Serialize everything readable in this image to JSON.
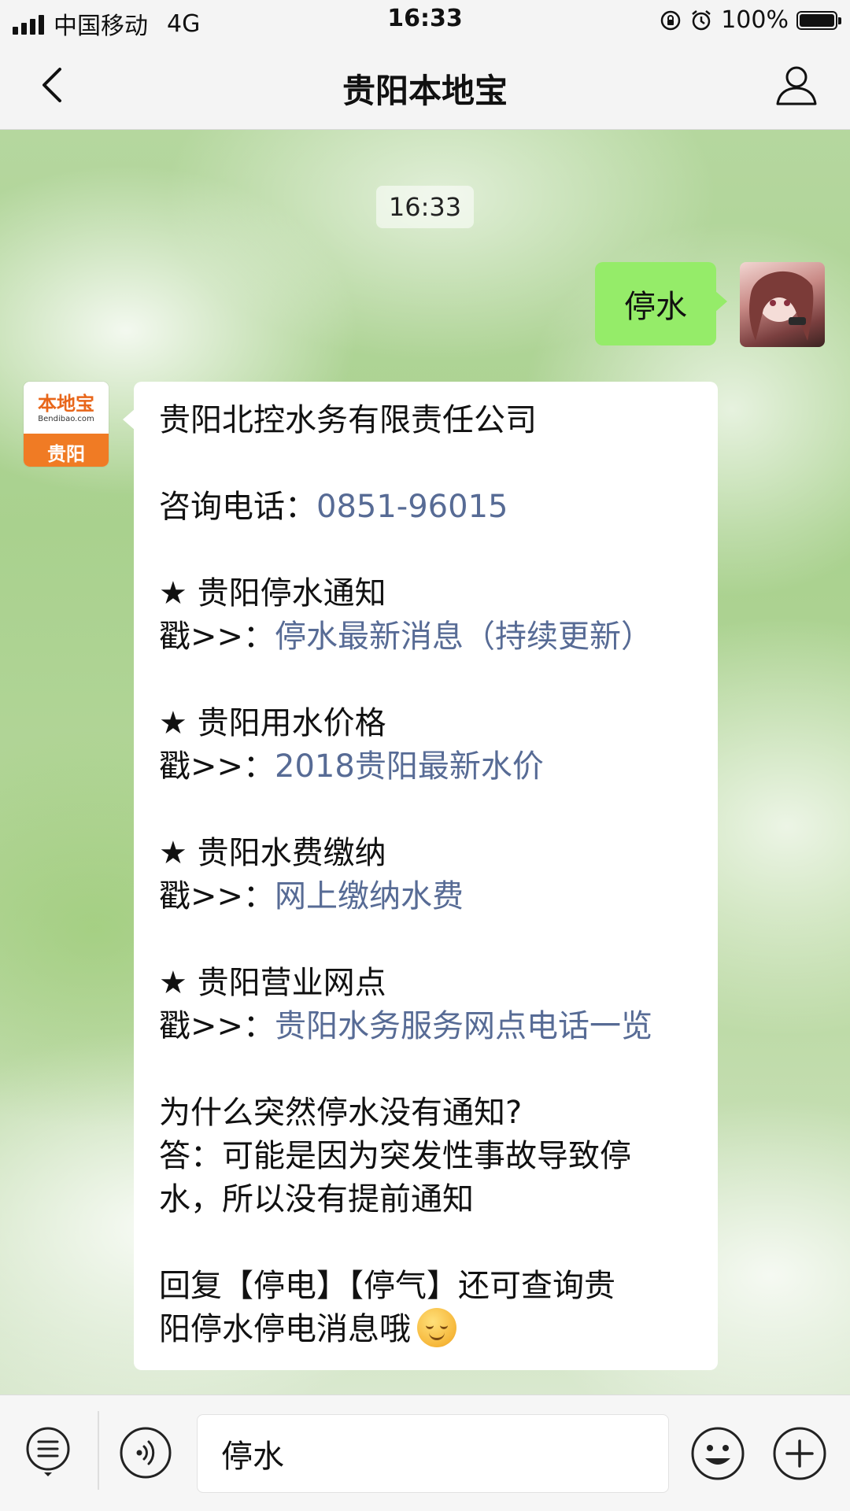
{
  "status_bar": {
    "carrier": "中国移动",
    "network": "4G",
    "time": "16:33",
    "battery": "100%",
    "battery_level": 1.0
  },
  "nav": {
    "title": "贵阳本地宝"
  },
  "chat": {
    "timestamp": "16:33",
    "sent_message": "停水",
    "bot_avatar": {
      "name": "本地宝",
      "domain": "Bendibao.com",
      "city": "贵阳",
      "colors": {
        "brand_orange": "#f07b24"
      }
    },
    "reply": {
      "company": "贵阳北控水务有限责任公司",
      "phone_label": "咨询电话：",
      "phone_number": "0851-96015",
      "star": "★",
      "poke_label": "戳>>：",
      "sections": [
        {
          "heading": "贵阳停水通知",
          "link": "停水最新消息（持续更新）"
        },
        {
          "heading": "贵阳用水价格",
          "link": "2018贵阳最新水价"
        },
        {
          "heading": "贵阳水费缴纳",
          "link": "网上缴纳水费"
        },
        {
          "heading": "贵阳营业网点",
          "link": "贵阳水务服务网点电话一览"
        }
      ],
      "faq_question": "为什么突然停水没有通知?",
      "faq_answer_line1": "答：可能是因为突发性事故导致停",
      "faq_answer_line2": "水，所以没有提前通知",
      "footer_line1": "回复【停电】【停气】还可查询贵",
      "footer_line2": "阳停水停电消息哦",
      "footer_emoji": "smiling-face-emoji"
    }
  },
  "input_bar": {
    "value": "停水"
  },
  "colors": {
    "sent_bubble": "#95ec69",
    "link": "#576b95",
    "bar_bg": "#f4f4f4"
  }
}
